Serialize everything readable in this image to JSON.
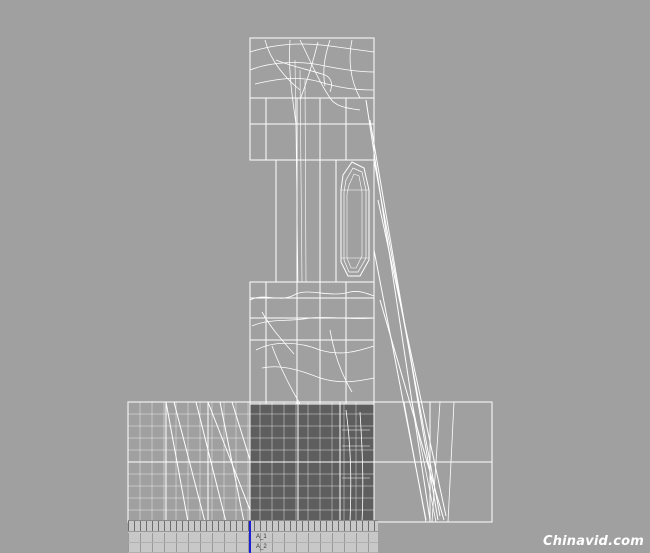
{
  "viewport": {
    "background": "#a0a0a0",
    "wire_color": "#ffffff",
    "selection_fill": "#5e5e5e"
  },
  "timeline": {
    "track_labels": [
      "A_1",
      "A_2"
    ],
    "playhead_color": "#1d1fd0"
  },
  "watermark": {
    "text": "Chinavid.com"
  }
}
